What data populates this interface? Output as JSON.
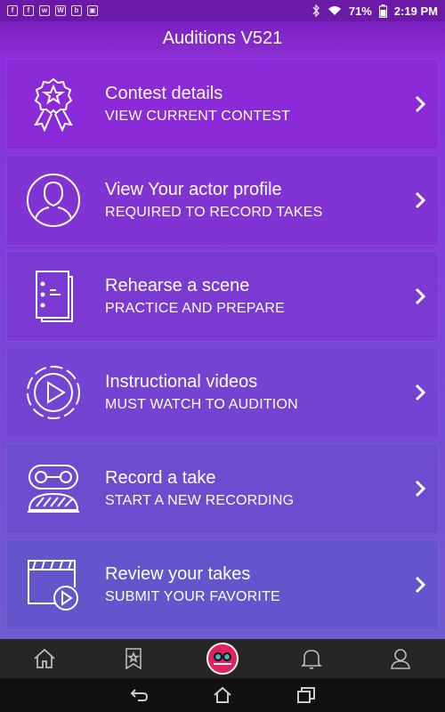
{
  "status_bar": {
    "battery": "71%",
    "time": "2:19 PM",
    "left_icons": [
      "facebook-notification-icon",
      "facebook-icon",
      "whatsapp-icon",
      "w-icon",
      "br-icon",
      "bag-icon"
    ],
    "right_icons": [
      "bluetooth-icon",
      "wifi-icon",
      "battery-icon"
    ]
  },
  "header": {
    "title": "Auditions V521"
  },
  "menu": {
    "items": [
      {
        "title": "Contest details",
        "subtitle": "VIEW CURRENT CONTEST",
        "icon": "ribbon-star-icon"
      },
      {
        "title": "View Your actor profile",
        "subtitle": "REQUIRED TO RECORD TAKES",
        "icon": "profile-icon"
      },
      {
        "title": "Rehearse a scene",
        "subtitle": "PRACTICE AND PREPARE",
        "icon": "script-icon"
      },
      {
        "title": "Instructional videos",
        "subtitle": "MUST WATCH TO AUDITION",
        "icon": "play-circle-icon"
      },
      {
        "title": "Record a take",
        "subtitle": "START A NEW RECORDING",
        "icon": "camera-reel-icon"
      },
      {
        "title": "Review your takes",
        "subtitle": "SUBMIT YOUR FAVORITE",
        "icon": "clapper-play-icon"
      }
    ]
  },
  "bottom_nav": [
    "home-icon",
    "bookmark-star-icon",
    "app-logo-icon",
    "bell-icon",
    "user-icon"
  ],
  "system_nav": [
    "back-icon",
    "home-icon",
    "recents-icon"
  ],
  "colors": {
    "accent": "#8a2ad8",
    "logo": "#e0225f"
  }
}
